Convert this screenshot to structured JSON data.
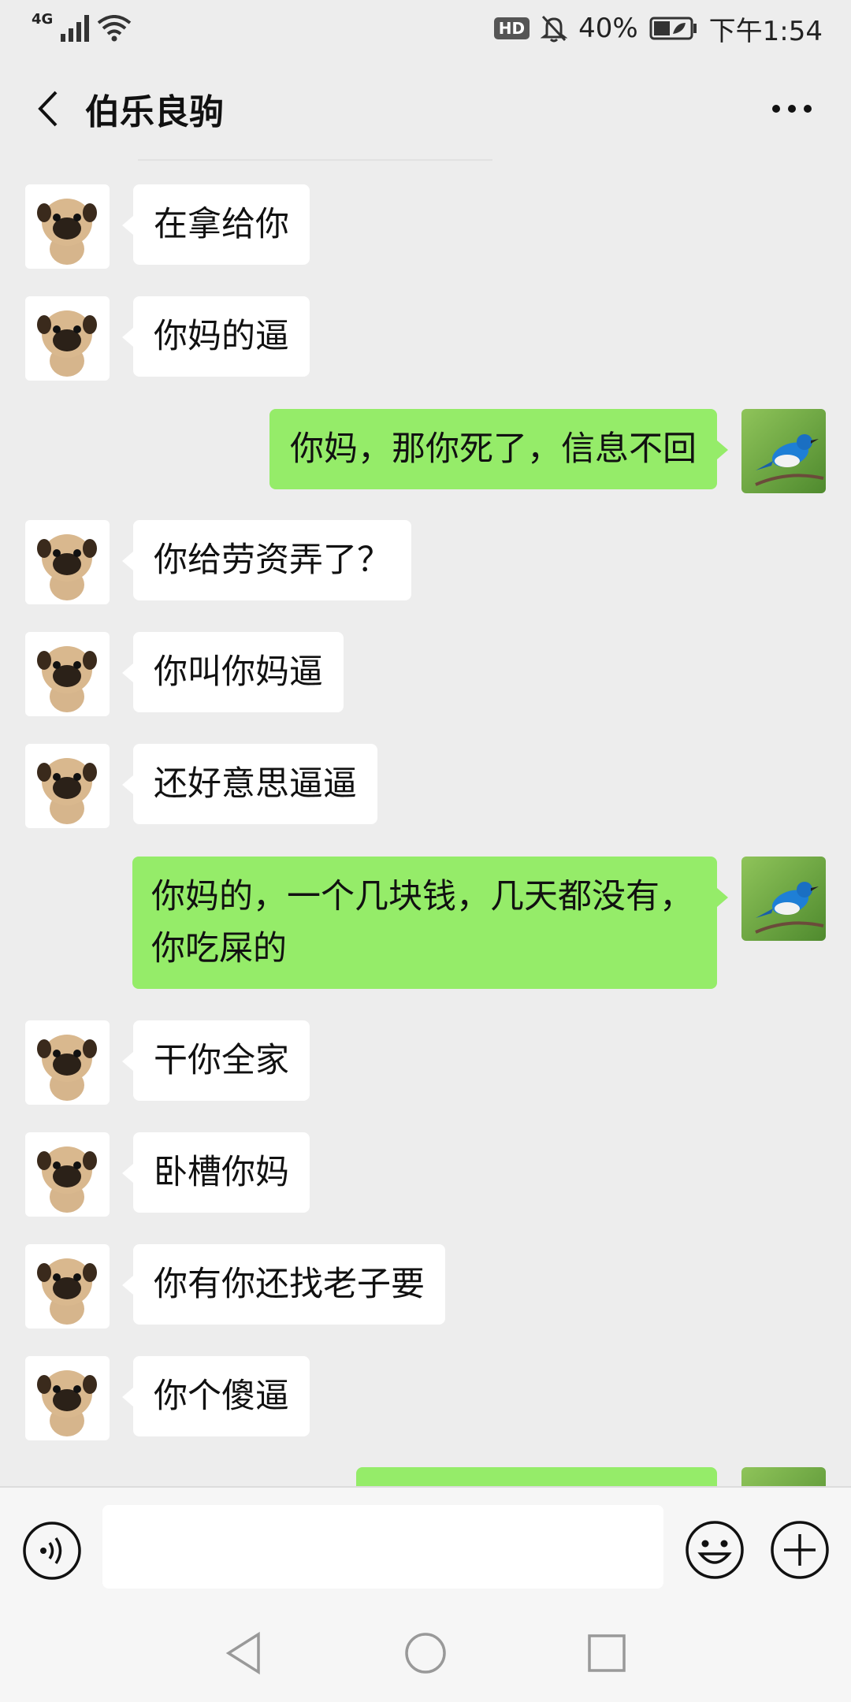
{
  "status_bar": {
    "network": "4G",
    "hd": "HD",
    "battery": "40%",
    "time": "下午1:54"
  },
  "header": {
    "title": "伯乐良驹"
  },
  "messages": [
    {
      "side": "in",
      "avatar": "pug-avatar",
      "text": "在拿给你"
    },
    {
      "side": "in",
      "avatar": "pug-avatar",
      "text": "你妈的逼"
    },
    {
      "side": "out",
      "avatar": "bird-avatar",
      "text": "你妈，那你死了，信息不回"
    },
    {
      "side": "in",
      "avatar": "pug-avatar",
      "text": "你给劳资弄了？"
    },
    {
      "side": "in",
      "avatar": "pug-avatar",
      "text": "你叫你妈逼"
    },
    {
      "side": "in",
      "avatar": "pug-avatar",
      "text": "还好意思逼逼"
    },
    {
      "side": "out",
      "avatar": "bird-avatar",
      "text": "你妈的，一个几块钱，几天都没有，\n你吃屎的"
    },
    {
      "side": "in",
      "avatar": "pug-avatar",
      "text": "干你全家"
    },
    {
      "side": "in",
      "avatar": "pug-avatar",
      "text": "卧槽你妈"
    },
    {
      "side": "in",
      "avatar": "pug-avatar",
      "text": "你有你还找老子要"
    },
    {
      "side": "in",
      "avatar": "pug-avatar",
      "text": "你个傻逼"
    },
    {
      "side": "out",
      "avatar": "bird-avatar",
      "text": ""
    }
  ],
  "input": {
    "value": "",
    "placeholder": ""
  },
  "colors": {
    "background": "#ededed",
    "outgoing_bubble": "#95ec69",
    "incoming_bubble": "#ffffff"
  }
}
